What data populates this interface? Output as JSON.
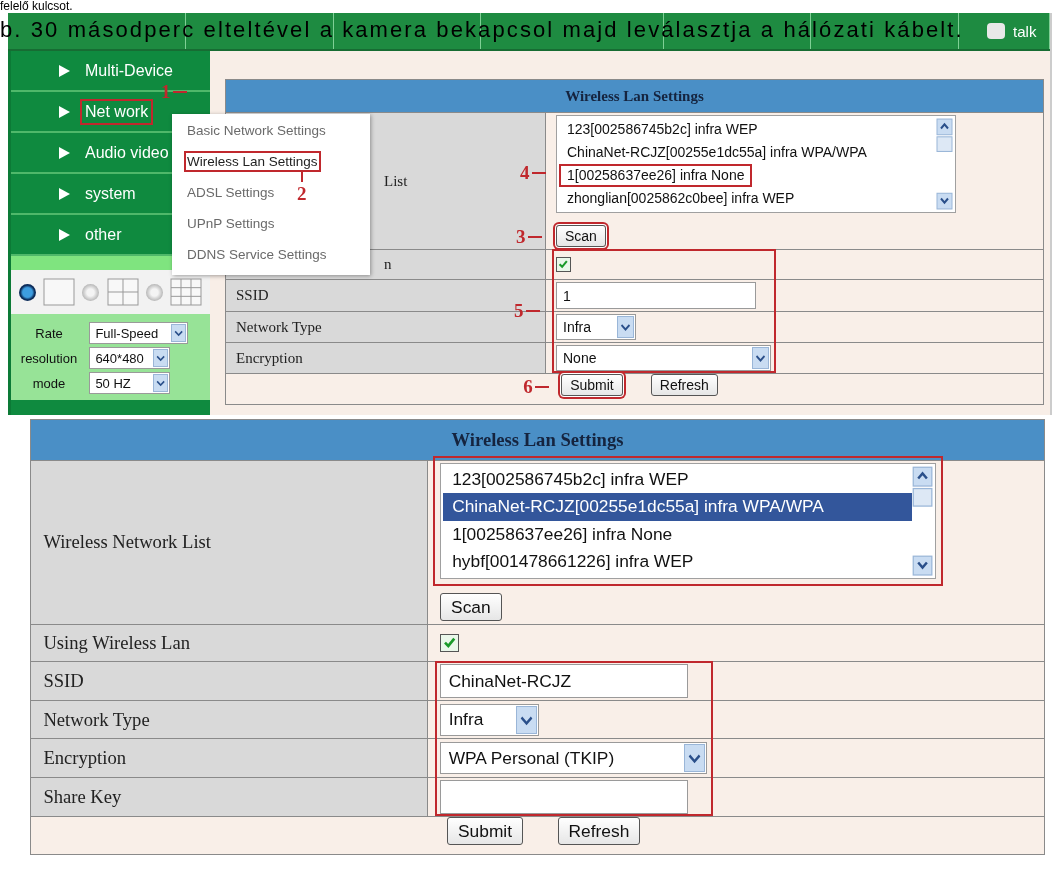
{
  "caption": {
    "cut_line": "felelő kulcsot.",
    "text": "b. 30 másodperc elteltével a kamera bekapcsol majd leválasztja a hálózati kábelt."
  },
  "top_screen": {
    "top_bar": {
      "talk_label": "talk"
    },
    "sidebar": {
      "items": [
        {
          "label": "Multi-Device",
          "highlighted": false
        },
        {
          "label": "Net work",
          "highlighted": true,
          "marker": "1"
        },
        {
          "label": "Audio video",
          "highlighted": false
        },
        {
          "label": "system",
          "highlighted": false
        },
        {
          "label": "other",
          "highlighted": false
        }
      ],
      "layout_options": [
        {
          "selected": true
        },
        {
          "selected": false
        },
        {
          "selected": false
        }
      ],
      "stream_settings": [
        {
          "label": "Rate",
          "value": "Full-Speed"
        },
        {
          "label": "resolution",
          "value": "640*480"
        },
        {
          "label": "mode",
          "value": "50 HZ"
        }
      ]
    },
    "popup_menu": {
      "items": [
        {
          "label": "Basic Network Settings",
          "highlighted": false
        },
        {
          "label": "Wireless Lan Settings",
          "highlighted": true,
          "marker": "2"
        },
        {
          "label": "ADSL Settings",
          "highlighted": false
        },
        {
          "label": "UPnP Settings",
          "highlighted": false
        },
        {
          "label": "DDNS Service Settings",
          "highlighted": false
        }
      ]
    },
    "panel": {
      "title": "Wireless Lan Settings",
      "list_label": "List",
      "list_label_covered": true,
      "list": {
        "highlighted": false,
        "items": [
          {
            "text": "123[002586745b2c] infra WEP",
            "selected": false,
            "highlighted": false
          },
          {
            "text": "ChinaNet-RCJZ[00255e1dc55a] infra WPA/WPA",
            "selected": false,
            "highlighted": false
          },
          {
            "text": "1[00258637ee26] infra None",
            "selected": false,
            "highlighted": true,
            "marker": "4"
          },
          {
            "text": "zhonglian[0025862c0bee] infra WEP",
            "selected": false,
            "highlighted": false
          }
        ]
      },
      "scan": {
        "label": "Scan",
        "highlighted": true,
        "marker": "3"
      },
      "fields": [
        {
          "kind": "checkbox",
          "label": "n",
          "covered": true,
          "checked": true,
          "in_group": true
        },
        {
          "kind": "text",
          "label": "SSID",
          "covered": false,
          "value": "1",
          "in_group": true
        },
        {
          "kind": "select",
          "label": "Network Type",
          "covered": false,
          "value": "Infra",
          "in_group": true
        },
        {
          "kind": "select",
          "label": "Encryption",
          "covered": false,
          "value": "None",
          "in_group": true
        }
      ],
      "group_marker": "5",
      "buttons": [
        {
          "label": "Submit",
          "highlighted": true,
          "marker": "6"
        },
        {
          "label": "Refresh",
          "highlighted": false
        }
      ]
    }
  },
  "bottom_screen": {
    "panel": {
      "title": "Wireless Lan Settings",
      "list_label": "Wireless Network List",
      "list_label_covered": false,
      "list": {
        "highlighted": true,
        "items": [
          {
            "text": "123[002586745b2c] infra WEP",
            "selected": false,
            "highlighted": false
          },
          {
            "text": "ChinaNet-RCJZ[00255e1dc55a] infra WPA/WPA",
            "selected": true,
            "highlighted": false
          },
          {
            "text": "1[00258637ee26] infra None",
            "selected": false,
            "highlighted": false
          },
          {
            "text": "hybf[001478661226] infra WEP",
            "selected": false,
            "highlighted": false
          }
        ]
      },
      "scan": {
        "label": "Scan",
        "highlighted": false
      },
      "fields": [
        {
          "kind": "checkbox",
          "label": "Using Wireless Lan",
          "covered": false,
          "checked": true,
          "in_group": false
        },
        {
          "kind": "text",
          "label": "SSID",
          "covered": false,
          "value": "ChinaNet-RCJZ",
          "in_group": true
        },
        {
          "kind": "select",
          "label": "Network Type",
          "covered": false,
          "value": "Infra",
          "in_group": true
        },
        {
          "kind": "select",
          "label": "Encryption",
          "covered": false,
          "value": "WPA Personal (TKIP)",
          "in_group": true
        },
        {
          "kind": "text",
          "label": "Share Key",
          "covered": false,
          "in_group": true
        }
      ],
      "buttons": [
        {
          "label": "Submit",
          "highlighted": false
        },
        {
          "label": "Refresh",
          "highlighted": false
        }
      ]
    }
  }
}
